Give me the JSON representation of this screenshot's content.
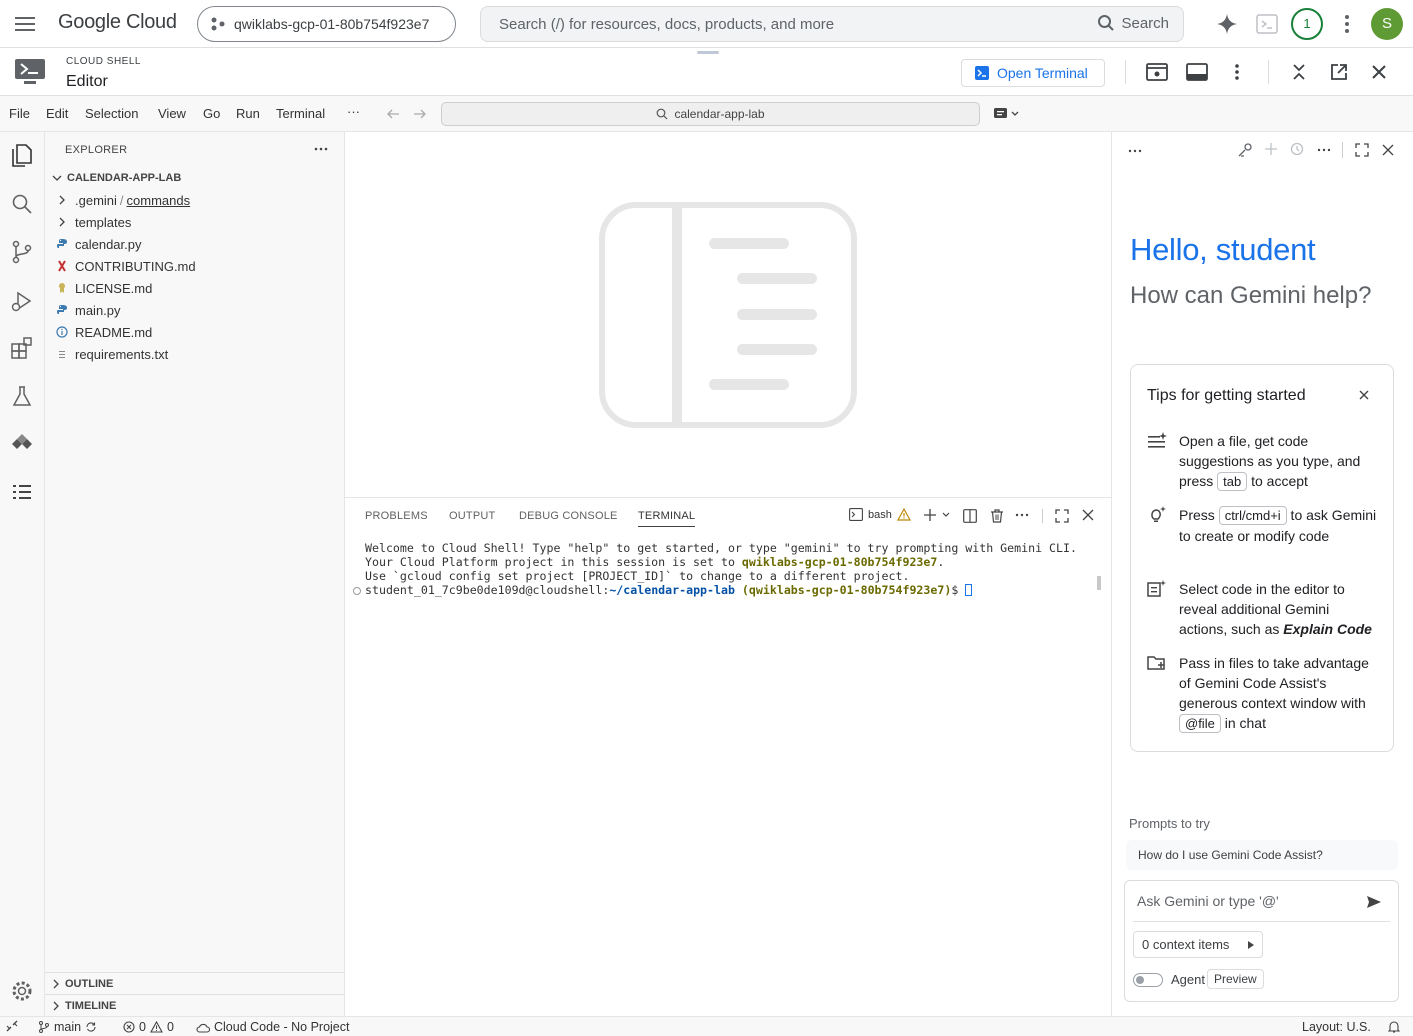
{
  "topbar": {
    "logo": "Google Cloud",
    "project": "qwiklabs-gcp-01-80b754f923e7",
    "search_placeholder": "Search (/) for resources, docs, products, and more",
    "search_button": "Search",
    "notifications": "1",
    "avatar_letter": "S"
  },
  "cloudshell": {
    "caption": "CLOUD SHELL",
    "title": "Editor",
    "open_terminal": "Open Terminal"
  },
  "menubar": {
    "items": [
      "File",
      "Edit",
      "Selection",
      "View",
      "Go",
      "Run",
      "Terminal",
      "···"
    ],
    "command_center": "calendar-app-lab"
  },
  "explorer": {
    "header": "EXPLORER",
    "root": "CALENDAR-APP-LAB",
    "folders": [
      {
        "name": ".gemini",
        "sep": "/",
        "sub": "commands"
      },
      {
        "name": "templates"
      }
    ],
    "files": [
      "calendar.py",
      "CONTRIBUTING.md",
      "LICENSE.md",
      "main.py",
      "README.md",
      "requirements.txt"
    ],
    "outline": "OUTLINE",
    "timeline": "TIMELINE"
  },
  "panel": {
    "tabs": [
      "PROBLEMS",
      "OUTPUT",
      "DEBUG CONSOLE",
      "TERMINAL"
    ],
    "shell": "bash",
    "terminal": {
      "line1": "Welcome to Cloud Shell! Type \"help\" to get started, or type \"gemini\" to try prompting with Gemini CLI.",
      "line2_prefix": "Your Cloud Platform project in this session is set to ",
      "line2_project": "qwiklabs-gcp-01-80b754f923e7",
      "line2_suffix": ".",
      "line3": "Use `gcloud config set project [PROJECT_ID]` to change to a different project.",
      "prompt_user": "student_01_7c9be0de109d@cloudshell:",
      "prompt_path": "~/calendar-app-lab",
      "prompt_project": " (qwiklabs-gcp-01-80b754f923e7)",
      "prompt_end": "$ "
    }
  },
  "gemini": {
    "hello": "Hello, student",
    "help": "How can Gemini help?",
    "tips_title": "Tips for getting started",
    "tip1_a": "Open a file, get code suggestions as you type, and press ",
    "tip1_key": "tab",
    "tip1_b": " to accept",
    "tip2_a": "Press ",
    "tip2_key": "ctrl/cmd+i",
    "tip2_b": " to ask Gemini to create or modify code",
    "tip3_a": "Select code in the editor to reveal additional Gemini actions, such as ",
    "tip3_b": "Explain Code",
    "tip4_a": "Pass in files to take advantage of Gemini Code Assist's generous context window with ",
    "tip4_key": "@file",
    "tip4_b": " in chat",
    "prompts_title": "Prompts to try",
    "prompt1": "How do I use Gemini Code Assist?",
    "ask_placeholder": "Ask Gemini or type '@'",
    "context_items": "0 context items",
    "agent": "Agent",
    "preview": "Preview"
  },
  "status": {
    "branch": "main",
    "errors": "0",
    "warnings": "0",
    "cloud_code": "Cloud Code - No Project",
    "layout": "Layout: U.S."
  },
  "colors": {
    "accent": "#1a73e8",
    "avatar_bg": "#5f9b35",
    "notif": "#188038"
  }
}
